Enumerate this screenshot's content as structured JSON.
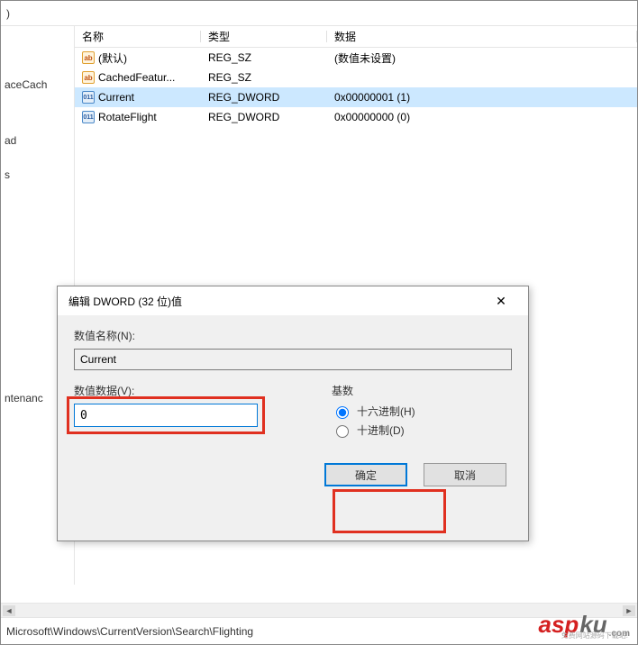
{
  "top_menu_fragment": ")",
  "tree": {
    "items": [
      "aceCach",
      "ad",
      "s",
      "ntenanc"
    ]
  },
  "list": {
    "columns": {
      "name": "名称",
      "type": "类型",
      "data": "数据"
    },
    "rows": [
      {
        "icon": "ab",
        "name": "(默认)",
        "type": "REG_SZ",
        "data": "(数值未设置)",
        "selected": false
      },
      {
        "icon": "ab",
        "name": "CachedFeatur...",
        "type": "REG_SZ",
        "data": "",
        "selected": false
      },
      {
        "icon": "dw",
        "name": "Current",
        "type": "REG_DWORD",
        "data": "0x00000001 (1)",
        "selected": true
      },
      {
        "icon": "dw",
        "name": "RotateFlight",
        "type": "REG_DWORD",
        "data": "0x00000000 (0)",
        "selected": false
      }
    ]
  },
  "dialog": {
    "title": "编辑 DWORD (32 位)值",
    "name_label": "数值名称(N):",
    "name_value": "Current",
    "data_label": "数值数据(V):",
    "data_value": "0",
    "base_label": "基数",
    "radio_hex": "十六进制(H)",
    "radio_dec": "十进制(D)",
    "ok": "确定",
    "cancel": "取消"
  },
  "statusbar": "Microsoft\\Windows\\CurrentVersion\\Search\\Flighting",
  "watermark": {
    "p1": "asp",
    "p2": "ku",
    "dom": ".com",
    "sub": "免费网站源码下载站!"
  }
}
